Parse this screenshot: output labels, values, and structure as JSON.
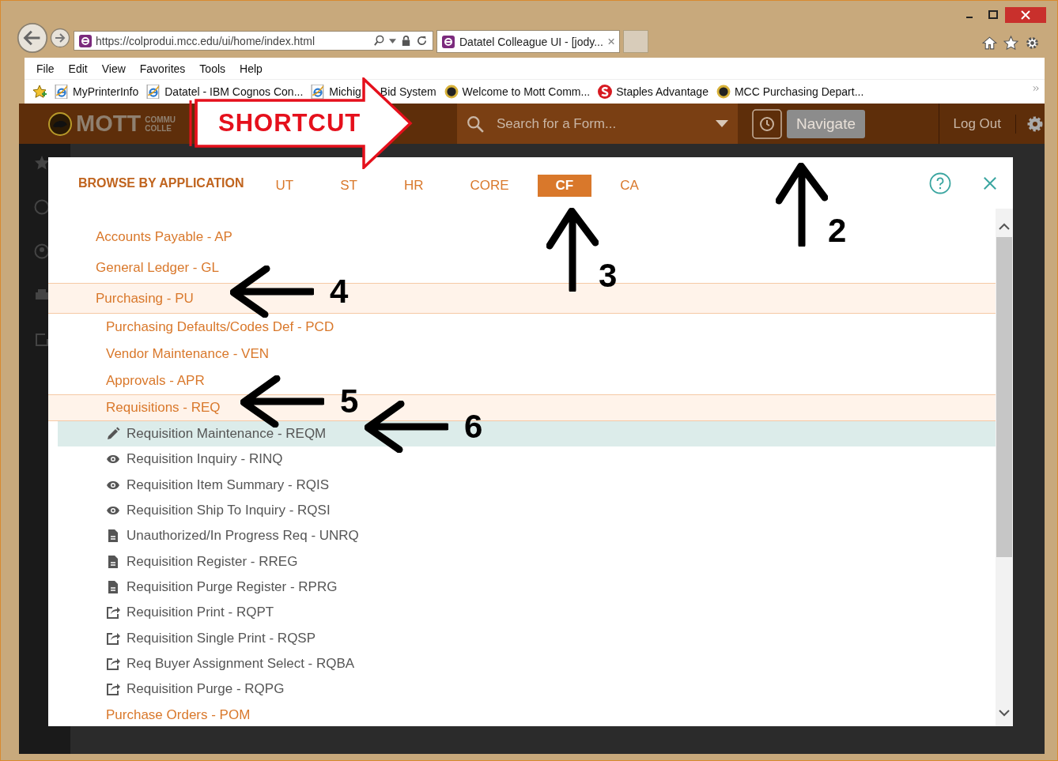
{
  "browser": {
    "address": "https://colprodui.mcc.edu/ui/home/index.html",
    "tabs": [
      {
        "title": "Datatel Colleague UI - [jody...",
        "selected": true
      }
    ],
    "menu": [
      "File",
      "Edit",
      "View",
      "Favorites",
      "Tools",
      "Help"
    ],
    "favorites": [
      {
        "label": "MyPrinterInfo",
        "kind": "ie"
      },
      {
        "label": "Datatel - IBM Cognos Con...",
        "kind": "ie"
      },
      {
        "label": "Michig",
        "kind": "ie"
      },
      {
        "label": "Bid System",
        "kind": "none"
      },
      {
        "label": "Welcome to Mott Comm...",
        "kind": "mott"
      },
      {
        "label": "Staples Advantage",
        "kind": "staples"
      },
      {
        "label": "MCC  Purchasing Depart...",
        "kind": "mott"
      }
    ]
  },
  "app": {
    "logo": [
      "MOTT",
      "COMMU",
      "COLLE"
    ],
    "search": {
      "placeholder": "Search for a Form..."
    },
    "navigate": "Navigate",
    "logout": "Log Out"
  },
  "modal": {
    "heading": "BROWSE BY APPLICATION",
    "tabs": [
      {
        "label": "UT",
        "selected": false
      },
      {
        "label": "ST",
        "selected": false
      },
      {
        "label": "HR",
        "selected": false
      },
      {
        "label": "CORE",
        "selected": false
      },
      {
        "label": "CF",
        "selected": true
      },
      {
        "label": "CA",
        "selected": false
      }
    ],
    "tree": [
      {
        "label": "Accounts Payable - AP",
        "kind": "group",
        "expanded": false
      },
      {
        "label": "General Ledger - GL",
        "kind": "group",
        "expanded": false
      },
      {
        "label": "Purchasing - PU",
        "kind": "group",
        "expanded": true,
        "children": [
          {
            "label": "Purchasing Defaults/Codes Def - PCD",
            "kind": "group",
            "expanded": false
          },
          {
            "label": "Vendor Maintenance - VEN",
            "kind": "group",
            "expanded": false
          },
          {
            "label": "Approvals - APR",
            "kind": "group",
            "expanded": false
          },
          {
            "label": "Requisitions - REQ",
            "kind": "group",
            "expanded": true,
            "children": [
              {
                "label": "Requisition Maintenance - REQM",
                "kind": "edit",
                "selected": true
              },
              {
                "label": "Requisition Inquiry - RINQ",
                "kind": "view",
                "selected": false
              },
              {
                "label": "Requisition Item Summary - RQIS",
                "kind": "view",
                "selected": false
              },
              {
                "label": "Requisition Ship To Inquiry - RQSI",
                "kind": "view",
                "selected": false
              },
              {
                "label": "Unauthorized/In Progress Req - UNRQ",
                "kind": "report",
                "selected": false
              },
              {
                "label": "Requisition Register - RREG",
                "kind": "report",
                "selected": false
              },
              {
                "label": "Requisition Purge Register - RPRG",
                "kind": "report",
                "selected": false
              },
              {
                "label": "Requisition Print - RQPT",
                "kind": "process",
                "selected": false
              },
              {
                "label": "Requisition Single Print - RQSP",
                "kind": "process",
                "selected": false
              },
              {
                "label": "Req Buyer Assignment Select - RQBA",
                "kind": "process",
                "selected": false
              },
              {
                "label": "Requisition Purge - RQPG",
                "kind": "process",
                "selected": false
              }
            ]
          },
          {
            "label": "Purchase Orders - POM",
            "kind": "group",
            "expanded": false
          }
        ]
      }
    ]
  },
  "annotations": [
    {
      "kind": "shortcut",
      "text": "SHORTCUT"
    },
    {
      "kind": "up",
      "text": "2"
    },
    {
      "kind": "up",
      "text": "3"
    },
    {
      "kind": "left",
      "text": "4"
    },
    {
      "kind": "left",
      "text": "5"
    },
    {
      "kind": "left",
      "text": "6"
    }
  ]
}
